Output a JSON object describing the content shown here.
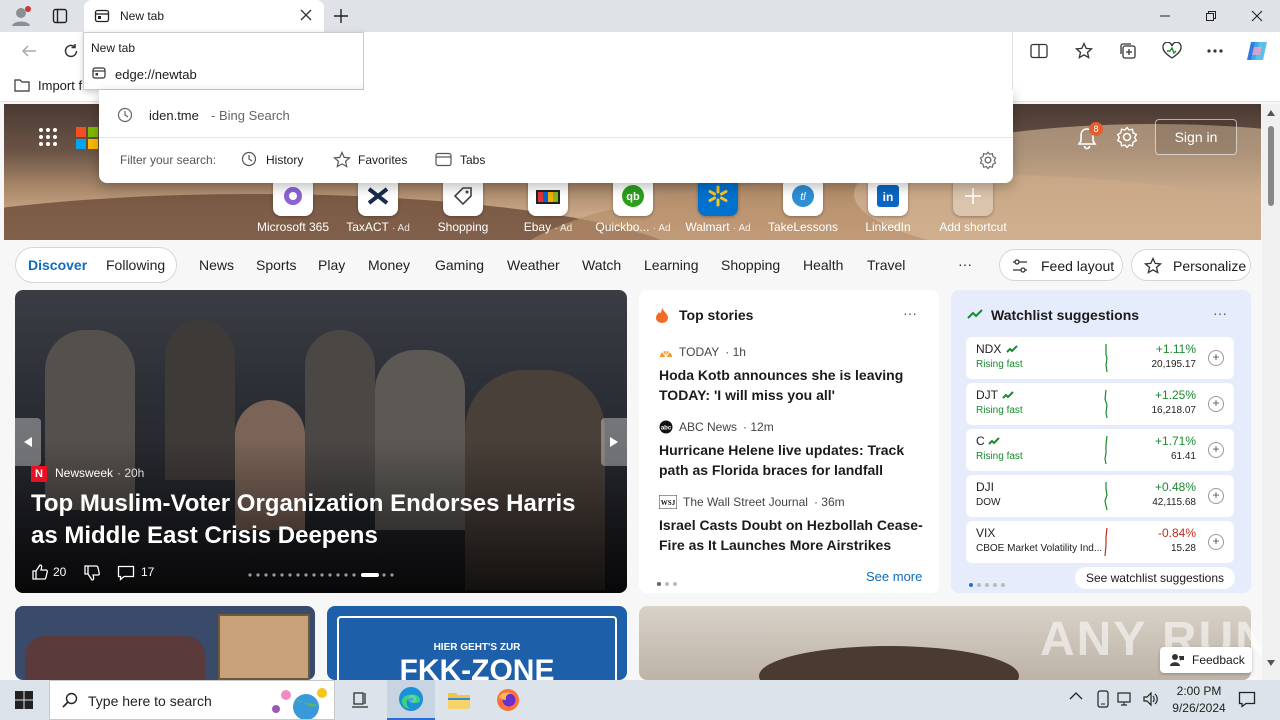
{
  "browser": {
    "tab_title": "New tab",
    "tooltip_title": "New tab",
    "tooltip_url": "edge://newtab",
    "favbar_import": "Import f"
  },
  "omnibox": {
    "suggestion_text": "iden.tme",
    "suggestion_suffix": "- Bing Search",
    "filter_label": "Filter your search:",
    "filters": [
      "History",
      "Favorites",
      "Tabs"
    ]
  },
  "header": {
    "notification_count": "8",
    "sign_in": "Sign in"
  },
  "shortcuts": [
    {
      "name": "Microsoft 365",
      "ad": ""
    },
    {
      "name": "TaxACT",
      "ad": "· Ad"
    },
    {
      "name": "Shopping",
      "ad": ""
    },
    {
      "name": "Ebay",
      "ad": "· Ad"
    },
    {
      "name": "Quickbo...",
      "ad": "· Ad"
    },
    {
      "name": "Walmart",
      "ad": "· Ad"
    },
    {
      "name": "TakeLessons",
      "ad": ""
    },
    {
      "name": "LinkedIn",
      "ad": ""
    },
    {
      "name": "Add shortcut",
      "ad": ""
    }
  ],
  "nav": {
    "discover": "Discover",
    "following": "Following",
    "items": [
      "News",
      "Sports",
      "Play",
      "Money",
      "Gaming",
      "Weather",
      "Watch",
      "Learning",
      "Shopping",
      "Health",
      "Travel"
    ],
    "more": "···",
    "feed_layout": "Feed layout",
    "personalize": "Personalize"
  },
  "hero_story": {
    "source": "Newsweek",
    "age": "· 20h",
    "headline": "Top Muslim-Voter Organization Endorses Harris as Middle East Crisis Deepens",
    "likes": "20",
    "comments": "17"
  },
  "top_stories": {
    "title": "Top stories",
    "more": "···",
    "items": [
      {
        "source": "TODAY",
        "age": "· 1h",
        "headline": "Hoda Kotb announces she is leaving TODAY: 'I will miss you all'"
      },
      {
        "source": "ABC News",
        "age": "· 12m",
        "headline": "Hurricane Helene live updates: Track path as Florida braces for landfall"
      },
      {
        "source": "The Wall Street Journal",
        "age": "· 36m",
        "headline": "Israel Casts Doubt on Hezbollah Cease-Fire as It Launches More Airstrikes"
      }
    ],
    "see_more": "See more"
  },
  "watchlist": {
    "title": "Watchlist suggestions",
    "more": "···",
    "rows": [
      {
        "symbol": "NDX",
        "sub": "Rising fast",
        "change": "+1.11%",
        "price": "20,195.17",
        "color": "#1a8a2e",
        "sub_color": "#1a8a2e"
      },
      {
        "symbol": "DJT",
        "sub": "Rising fast",
        "change": "+1.25%",
        "price": "16,218.07",
        "color": "#1a8a2e",
        "sub_color": "#1a8a2e"
      },
      {
        "symbol": "C",
        "sub": "Rising fast",
        "change": "+1.71%",
        "price": "61.41",
        "color": "#1a8a2e",
        "sub_color": "#1a8a2e"
      },
      {
        "symbol": "DJI",
        "sub": "DOW",
        "change": "+0.48%",
        "price": "42,115.68",
        "color": "#1a8a2e",
        "sub_color": "#222"
      },
      {
        "symbol": "VIX",
        "sub": "CBOE Market Volatility Ind...",
        "change": "-0.84%",
        "price": "15.28",
        "color": "#c42b1c",
        "sub_color": "#222"
      }
    ],
    "see_all": "See watchlist suggestions"
  },
  "lower_cards": {
    "ekk_small": "HIER GEHT'S ZUR",
    "ekk_big": "FKK-ZONE"
  },
  "feedback": "Feedback",
  "watermark": "ANY RUN",
  "taskbar": {
    "search_placeholder": "Type here to search",
    "time": "2:00 PM",
    "date": "9/26/2024"
  }
}
